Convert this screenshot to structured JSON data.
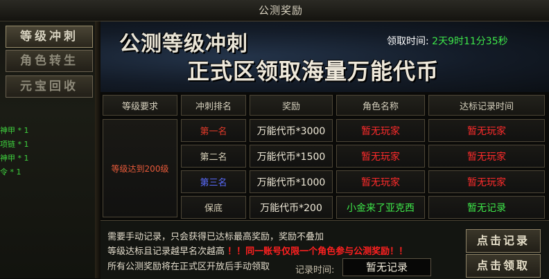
{
  "window": {
    "title": "公测奖励"
  },
  "sidebar": {
    "items": [
      {
        "label": "等级冲刺",
        "active": true
      },
      {
        "label": "角色转生",
        "active": false
      },
      {
        "label": "元宝回收",
        "active": false
      }
    ]
  },
  "inventory_overlay": [
    {
      "text": "神甲 * 1"
    },
    {
      "text": "项链 * 1"
    },
    {
      "text": "神甲 * 1"
    },
    {
      "text": "令 * 1"
    }
  ],
  "banner": {
    "line1": "公测等级冲刺",
    "line2": "正式区领取海量万能代币",
    "timer_label": "领取时间:",
    "timer_value": "2天9时11分35秒"
  },
  "table": {
    "headers": [
      "等级要求",
      "冲刺排名",
      "奖励",
      "角色名称",
      "达标记录时间"
    ],
    "requirement": "等级达到200级",
    "rows": [
      {
        "rank": "第一名",
        "reward": "万能代币*3000",
        "name": "暂无玩家",
        "time": "暂无玩家"
      },
      {
        "rank": "第二名",
        "reward": "万能代币*1500",
        "name": "暂无玩家",
        "time": "暂无玩家"
      },
      {
        "rank": "第三名",
        "reward": "万能代币*1000",
        "name": "暂无玩家",
        "time": "暂无玩家"
      },
      {
        "rank": "保底",
        "reward": "万能代币*200",
        "name": "小金来了亚克西",
        "time": "暂无记录"
      }
    ]
  },
  "notes": {
    "line1": "需要手动记录，只会获得已达标最高奖励，奖励不叠加",
    "line2": "等级达标且记录越早名次越高",
    "line2_warn": "！！同一账号仅限一个角色参与公测奖励！！",
    "line3": "所有公测奖励将在正式区开放后手动领取"
  },
  "record": {
    "label": "记录时间:",
    "value": "暂无记录"
  },
  "buttons": {
    "record": "点击记录",
    "claim": "点击领取"
  },
  "colors": {
    "rank1": "#e23a2a",
    "rank2": "#d8d0b8",
    "rank3": "#5a6cff",
    "rank_floor": "#d8d0b8",
    "no_player": "#ff2b2b",
    "player_name": "#3ee84a",
    "no_record": "#3ee84a",
    "requirement": "#e85a3a"
  }
}
